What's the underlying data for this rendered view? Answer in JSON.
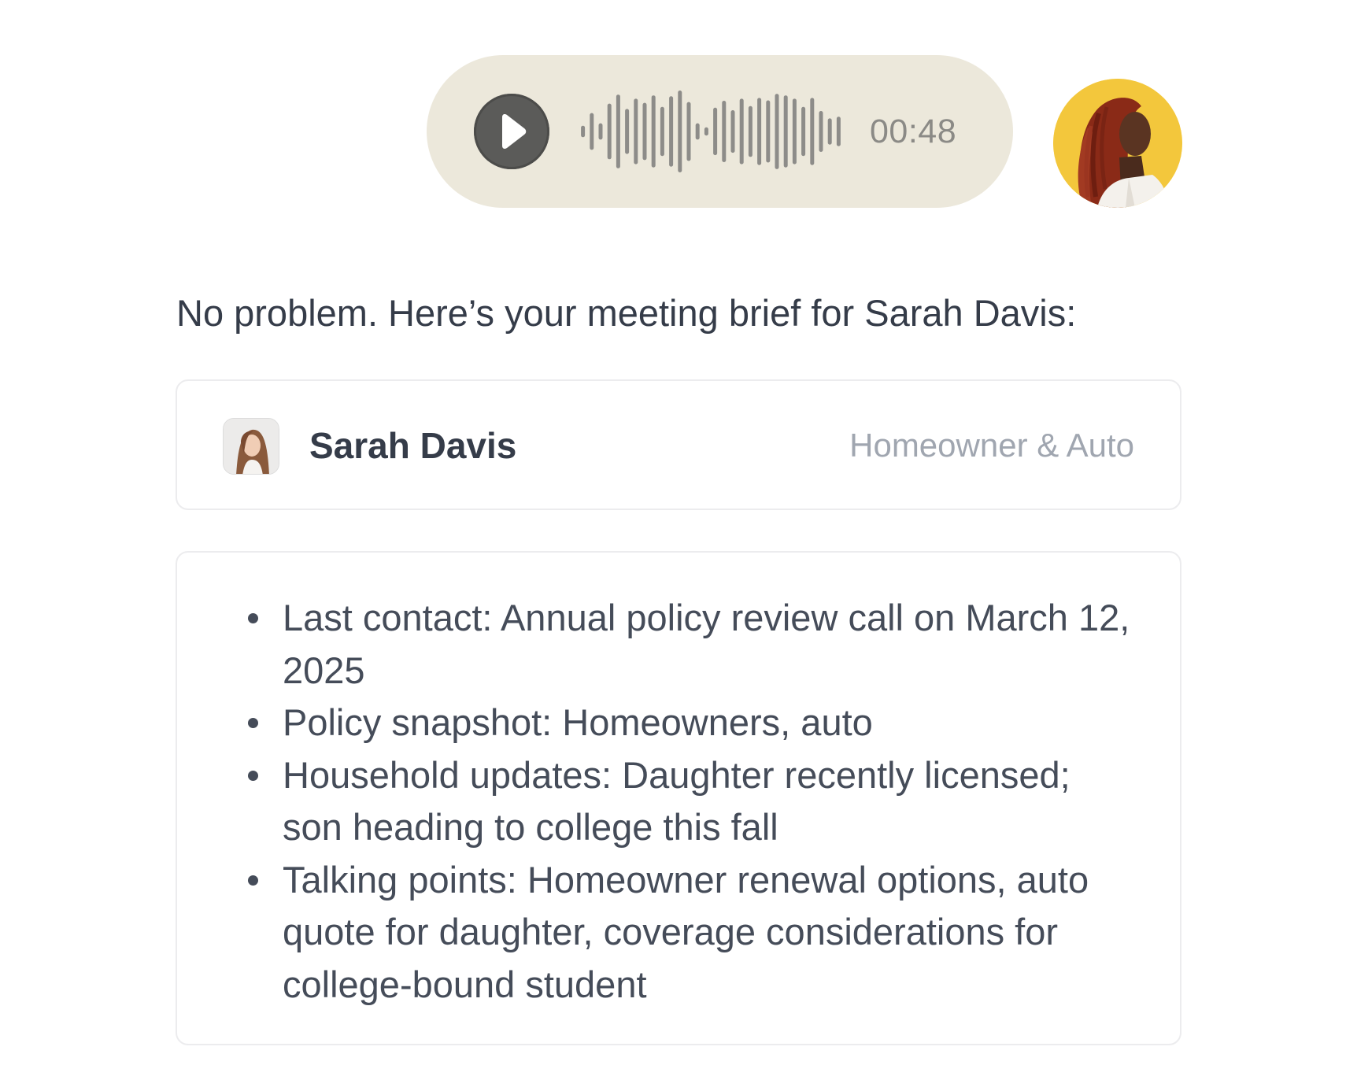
{
  "voice_message": {
    "duration": "00:48",
    "play_icon": "play-icon",
    "bubble_color": "#ece8db",
    "button_color": "#5b5b59",
    "waveform_color": "#8d8c89",
    "waveform_bars": [
      0.14,
      0.45,
      0.2,
      0.68,
      0.9,
      0.55,
      0.8,
      0.7,
      0.88,
      0.6,
      0.86,
      1.0,
      0.72,
      0.2,
      0.1,
      0.58,
      0.75,
      0.52,
      0.8,
      0.62,
      0.82,
      0.76,
      0.92,
      0.88,
      0.8,
      0.6,
      0.82,
      0.5,
      0.32,
      0.36
    ]
  },
  "user_avatar": {
    "alt": "user-avatar",
    "background": "#f3c73c"
  },
  "assistant": {
    "reply": "No problem. Here’s your meeting brief for Sarah Davis:"
  },
  "contact": {
    "name": "Sarah Davis",
    "policy_tag": "Homeowner & Auto"
  },
  "brief": {
    "items": [
      "Last contact: Annual policy review call on March 12, 2025",
      "Policy snapshot: Homeowners, auto",
      "Household updates: Daughter recently licensed; son heading to college this fall",
      "Talking points: Homeowner renewal options, auto quote for daughter, coverage considerations for college-bound student"
    ]
  }
}
